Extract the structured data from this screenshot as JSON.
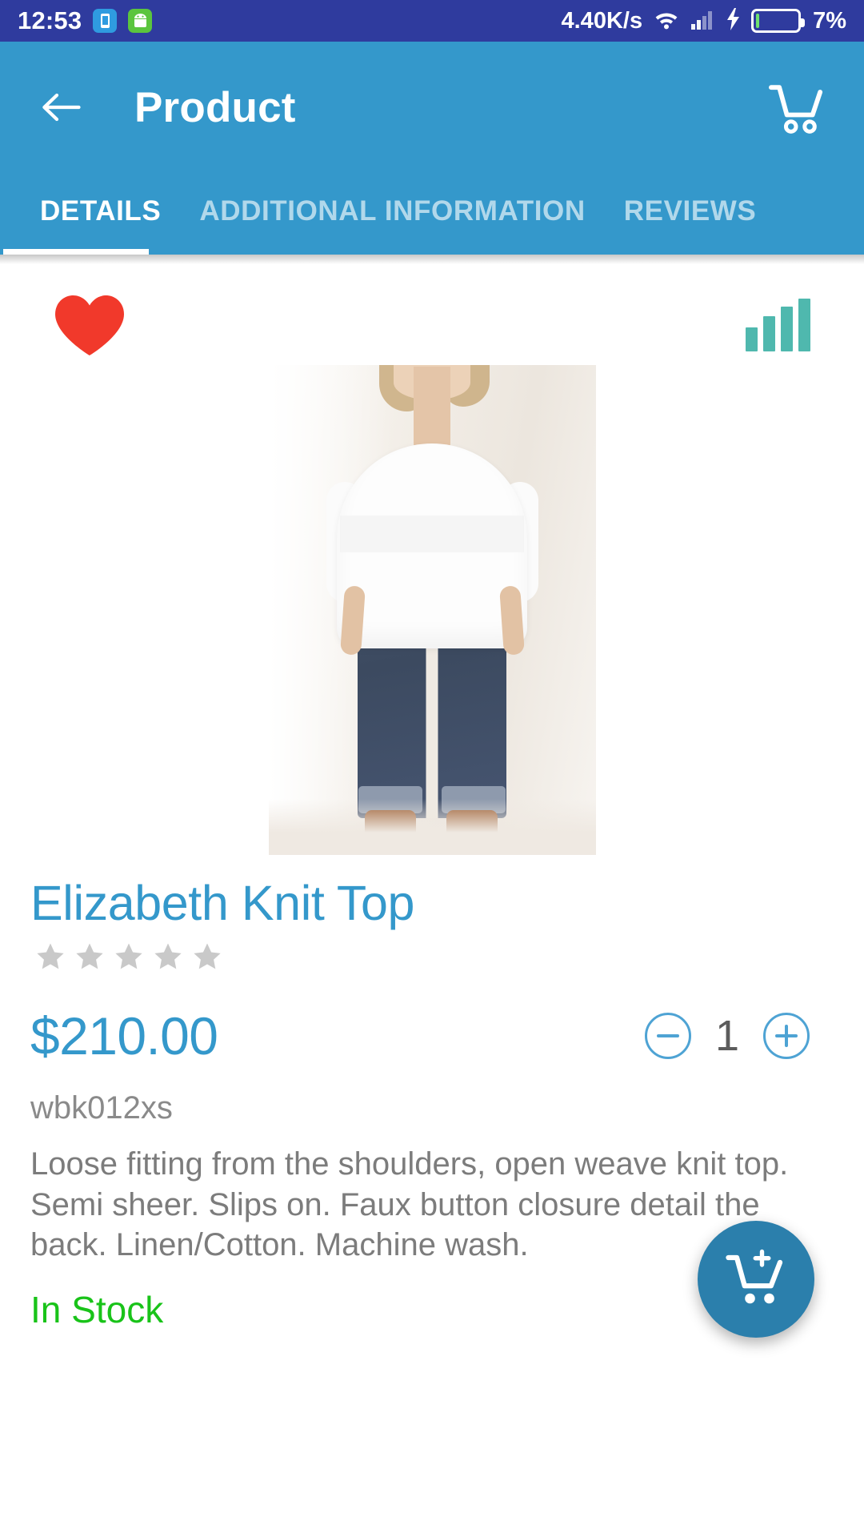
{
  "status_bar": {
    "time": "12:53",
    "network_speed": "4.40K/s",
    "battery_percent": "7%",
    "battery_level": 7,
    "icons": [
      "app-icon-blue",
      "app-icon-android-green",
      "wifi-icon",
      "cellular-signal-icon",
      "charging-bolt-icon",
      "battery-icon"
    ],
    "colors": {
      "background": "#2F3B9E",
      "foreground": "#FFFFFF",
      "battery_fill": "#6FE06F"
    }
  },
  "appbar": {
    "title": "Product",
    "back_icon": "back-arrow-icon",
    "cart_icon": "shopping-cart-icon",
    "color": "#3498CB"
  },
  "tabs": {
    "items": [
      {
        "label": "DETAILS",
        "active": true
      },
      {
        "label": "ADDITIONAL INFORMATION",
        "active": false
      },
      {
        "label": "REVIEWS",
        "active": false
      }
    ]
  },
  "actions": {
    "favorite_icon": "heart-icon",
    "favorite_color": "#F1392B",
    "compare_icon": "bar-chart-icon",
    "compare_color": "#4FB8AE"
  },
  "product": {
    "image_alt": "Woman wearing white knit top and blue jeans with brown clog sandals",
    "title": "Elizabeth Knit Top",
    "title_color": "#3498CB",
    "rating": 0,
    "rating_max": 5,
    "star_empty_color": "#C9C9C9",
    "price": "$210.00",
    "price_color": "#3498CB",
    "sku": "wbk012xs",
    "description": "Loose fitting from the shoulders, open weave knit top. Semi sheer.  Slips on. Faux button closure detail the back. Linen/Cotton. Machine wash.",
    "stock_status": "In Stock",
    "stock_color": "#19C319"
  },
  "quantity": {
    "value": "1",
    "decrement_label": "−",
    "increment_label": "+",
    "control_color": "#4EA3D4"
  },
  "fab": {
    "icon": "add-to-cart-icon",
    "color": "#2B7FAC"
  }
}
